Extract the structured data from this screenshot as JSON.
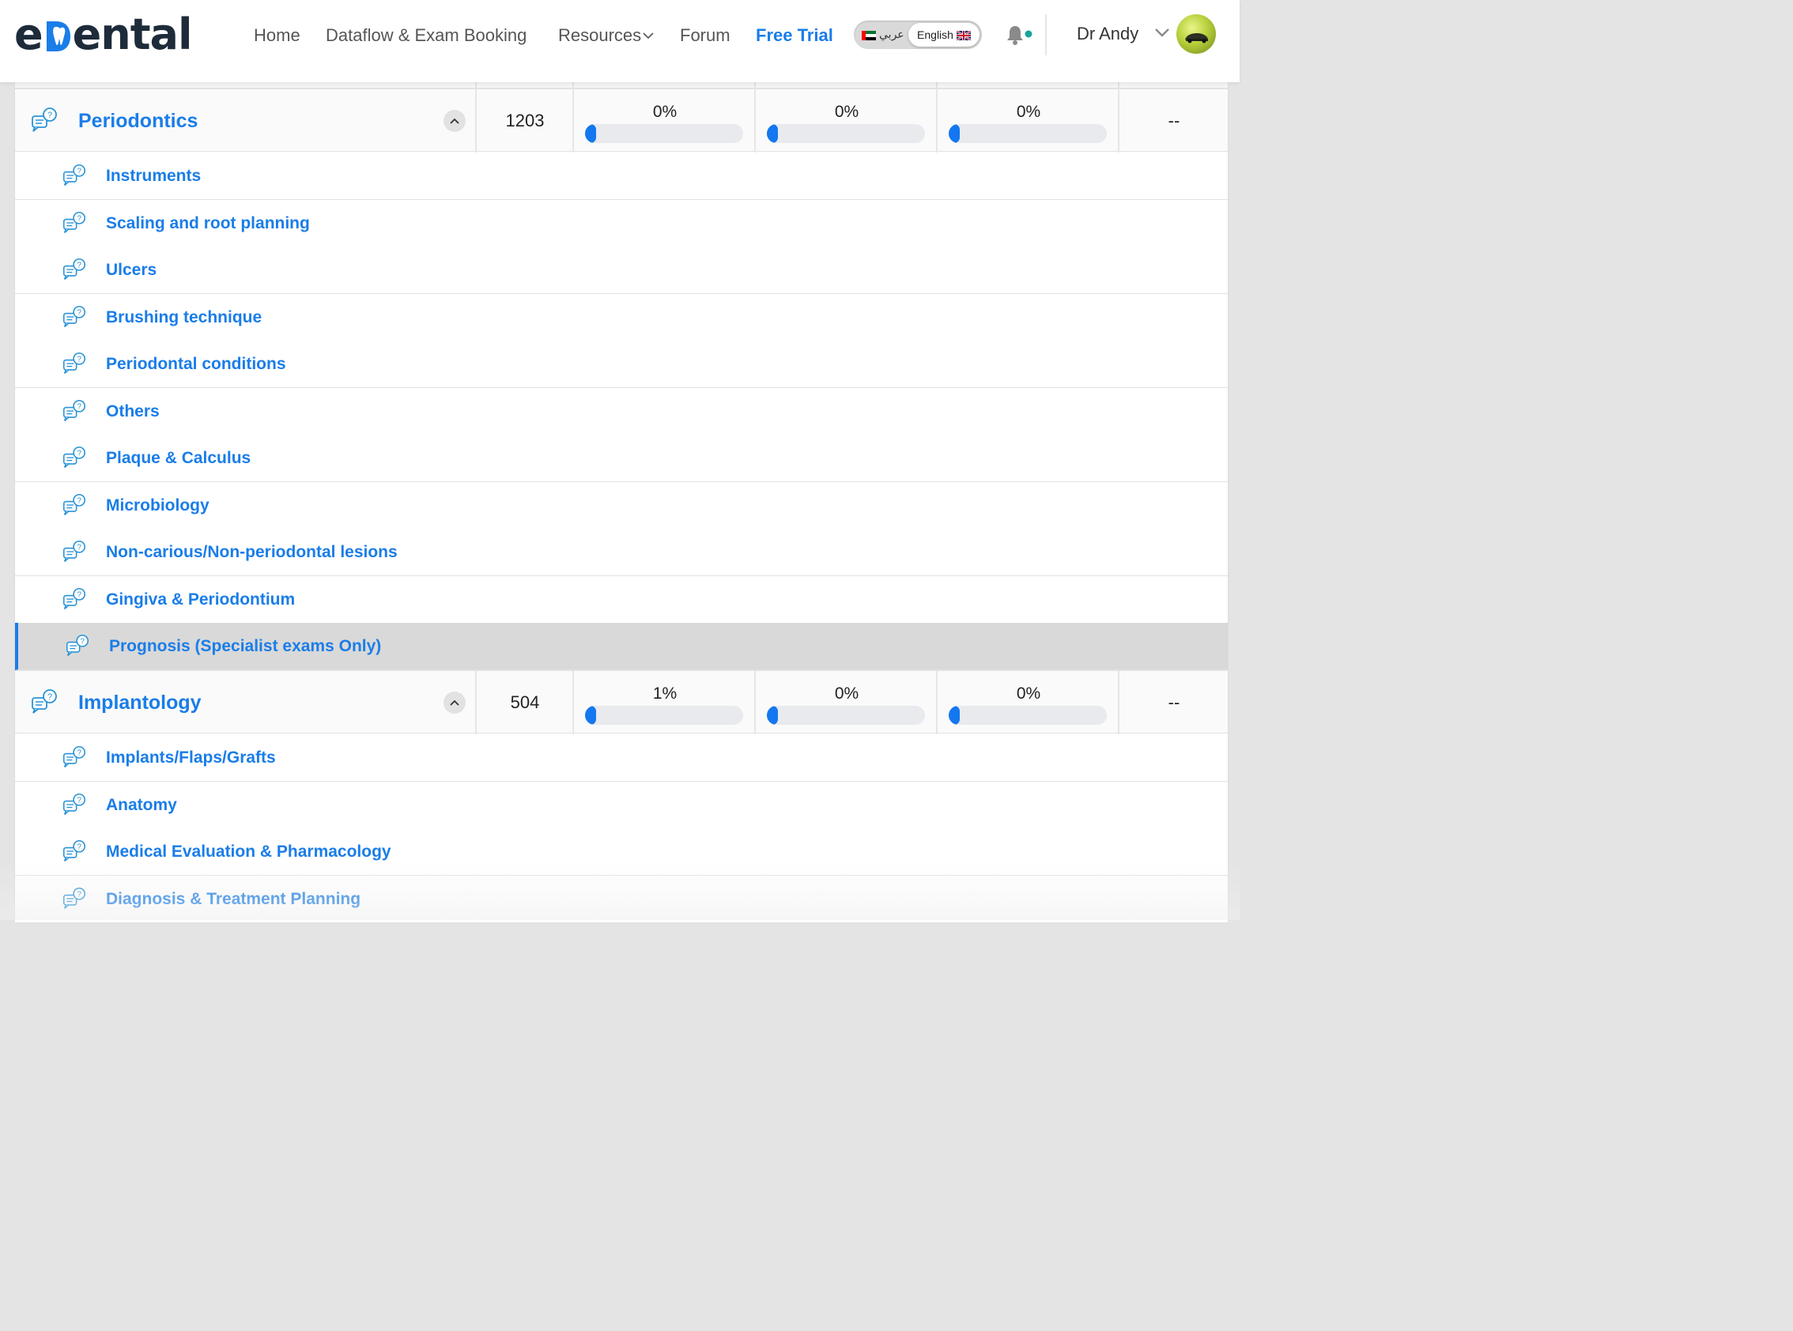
{
  "header": {
    "logo_text": "eDental",
    "nav": {
      "home": "Home",
      "dataflow": "Dataflow & Exam Booking",
      "resources": "Resources",
      "forum": "Forum",
      "free_trial": "Free Trial"
    },
    "language": {
      "arabic": "عربي",
      "english": "English"
    },
    "user_name": "Dr Andy",
    "notification_dot_color": "#1aa39a"
  },
  "colors": {
    "accent": "#1a7de8",
    "progress_fill": "#1477f0",
    "progress_track": "#e8eaee"
  },
  "categories": [
    {
      "title": "Periodontics",
      "count": "1203",
      "progress": [
        {
          "label": "0%",
          "value": 0
        },
        {
          "label": "0%",
          "value": 0
        },
        {
          "label": "0%",
          "value": 0
        }
      ],
      "last": "--",
      "topics": [
        "Instruments",
        "Scaling and root planning",
        "Ulcers",
        "Brushing technique",
        "Periodontal conditions",
        "Others",
        "Plaque & Calculus",
        "Microbiology",
        "Non-carious/Non-periodontal lesions",
        "Gingiva & Periodontium",
        "Prognosis (Specialist exams Only)"
      ],
      "active_topic": "Prognosis (Specialist exams Only)"
    },
    {
      "title": "Implantology",
      "count": "504",
      "progress": [
        {
          "label": "1%",
          "value": 1
        },
        {
          "label": "0%",
          "value": 0
        },
        {
          "label": "0%",
          "value": 0
        }
      ],
      "last": "--",
      "topics": [
        "Implants/Flaps/Grafts",
        "Anatomy",
        "Medical Evaluation & Pharmacology",
        "Diagnosis & Treatment Planning"
      ],
      "active_topic": ""
    }
  ]
}
